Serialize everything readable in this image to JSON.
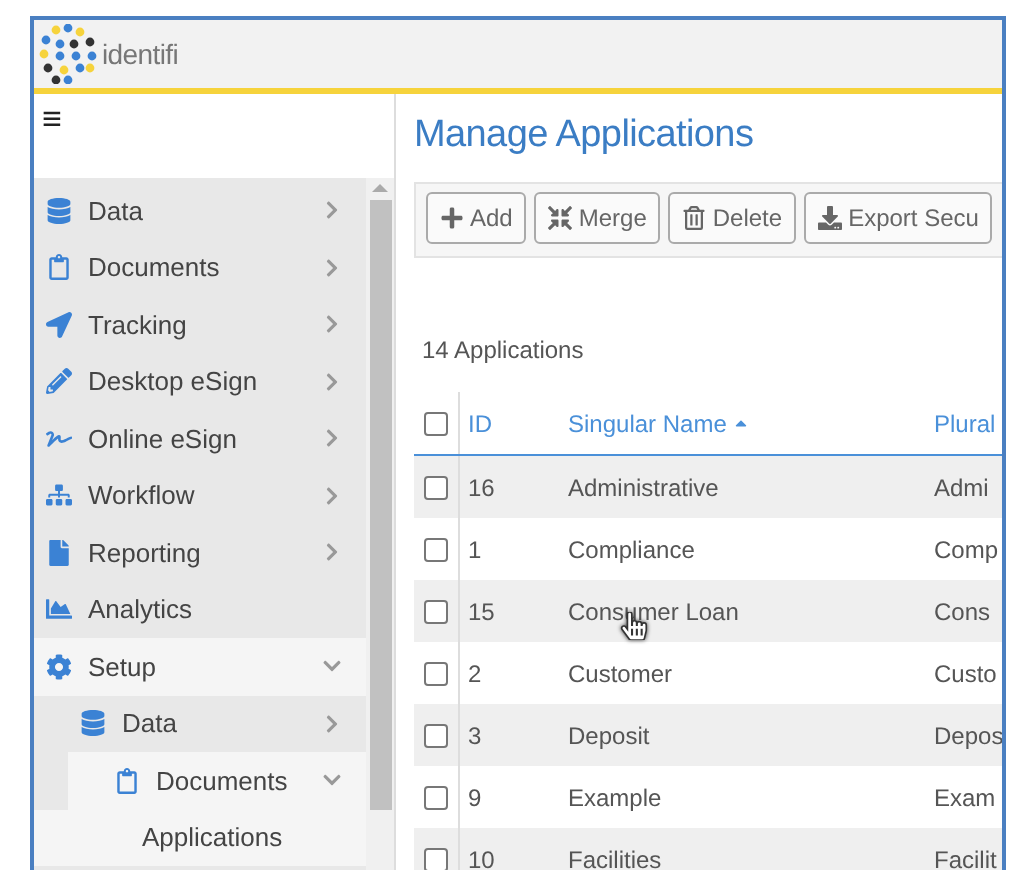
{
  "header": {
    "logo_text": "identifi"
  },
  "sidebar": {
    "menu_icon": "≡",
    "items": [
      {
        "label": "Data",
        "kind": "group",
        "expanded": false,
        "selected": false
      },
      {
        "label": "Documents",
        "kind": "group",
        "expanded": false,
        "selected": false
      },
      {
        "label": "Tracking",
        "kind": "group",
        "expanded": false,
        "selected": false
      },
      {
        "label": "Desktop eSign",
        "kind": "group",
        "expanded": false,
        "selected": false
      },
      {
        "label": "Online eSign",
        "kind": "group",
        "expanded": false,
        "selected": false
      },
      {
        "label": "Workflow",
        "kind": "group",
        "expanded": false,
        "selected": false
      },
      {
        "label": "Reporting",
        "kind": "group",
        "expanded": false,
        "selected": false
      },
      {
        "label": "Analytics",
        "kind": "link",
        "selected": false
      },
      {
        "label": "Setup",
        "kind": "group",
        "expanded": true,
        "selected": true,
        "children": [
          {
            "label": "Data",
            "kind": "group",
            "expanded": false,
            "selected": false
          },
          {
            "label": "Documents",
            "kind": "group",
            "expanded": true,
            "selected": true,
            "children": [
              {
                "label": "Applications",
                "kind": "link",
                "selected": true
              }
            ]
          }
        ]
      }
    ]
  },
  "page": {
    "title": "Manage Applications",
    "toolbar": [
      "Add",
      "Merge",
      "Delete",
      "Export Secu"
    ],
    "count": "14 Applications",
    "table": {
      "select_all_checked": false,
      "columns": [
        {
          "label": "ID",
          "sorted": false
        },
        {
          "label": "Singular Name",
          "sorted": true
        },
        {
          "label": "Plural",
          "sorted": false
        }
      ],
      "rows": [
        {
          "id": "16",
          "singular": "Administrative",
          "plural": "Admi",
          "checked": false
        },
        {
          "id": "1",
          "singular": "Compliance",
          "plural": "Comp",
          "checked": false
        },
        {
          "id": "15",
          "singular": "Consumer Loan",
          "plural": "Cons",
          "checked": false,
          "pointer": true
        },
        {
          "id": "2",
          "singular": "Customer",
          "plural": "Custo",
          "checked": false
        },
        {
          "id": "3",
          "singular": "Deposit",
          "plural": "Depos",
          "checked": false
        },
        {
          "id": "9",
          "singular": "Example",
          "plural": "Exam",
          "checked": false
        },
        {
          "id": "10",
          "singular": "Facilities",
          "plural": "Facilit",
          "checked": false
        }
      ]
    }
  }
}
